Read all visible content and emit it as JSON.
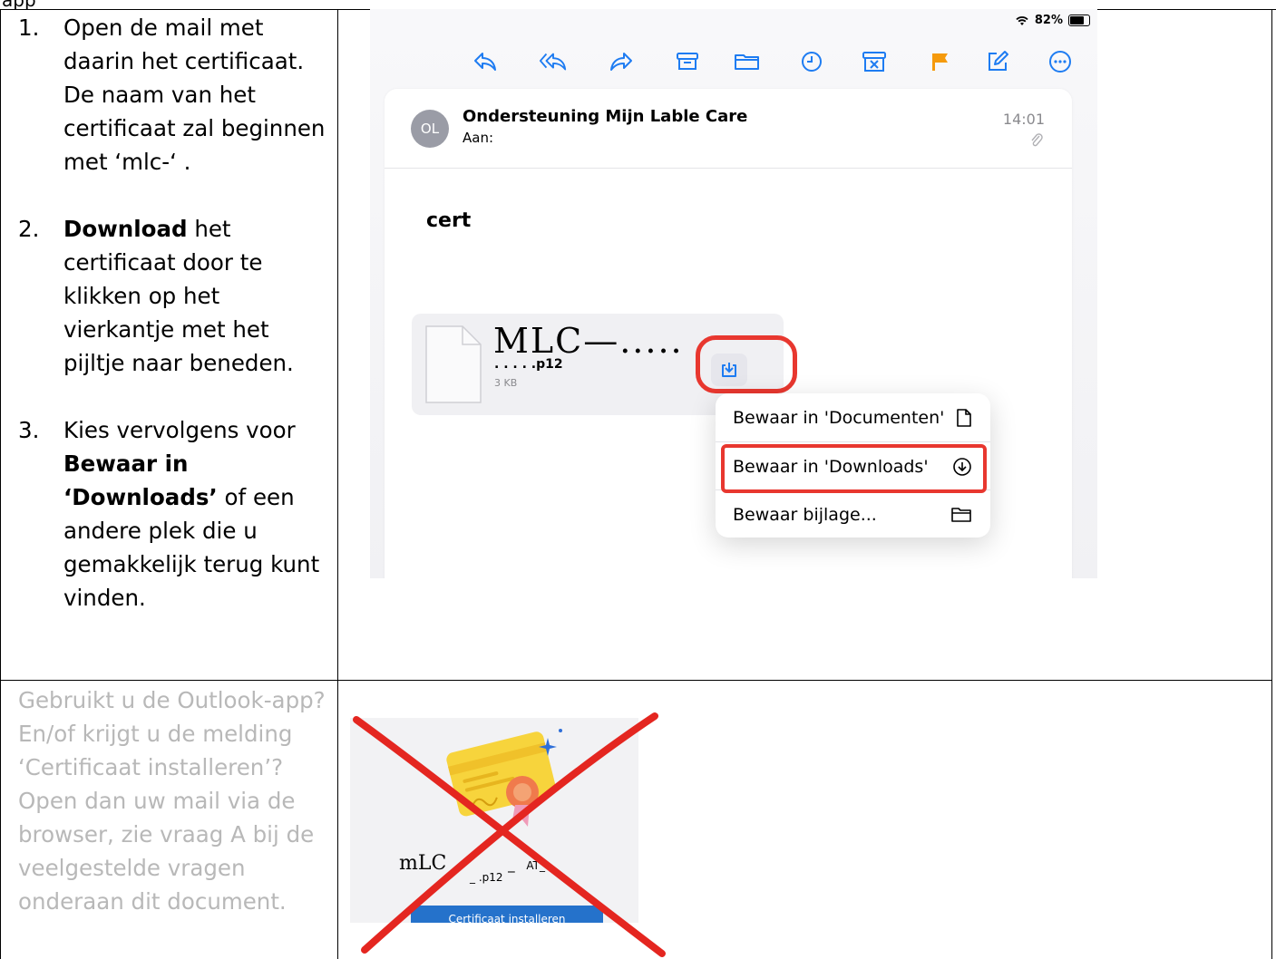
{
  "header_fragment": "app",
  "steps": [
    {
      "num": "1.",
      "parts": [
        "Open de mail met daarin het certificaat. De naam van het certificaat zal beginnen met ‘mlc-‘ ."
      ]
    },
    {
      "num": "2.",
      "bold": "Download",
      "rest": " het certificaat door te klikken op het vierkantje met het pijltje naar beneden."
    },
    {
      "num": "3.",
      "pre": "Kies vervolgens voor ",
      "bold": "Bewaar in ‘Downloads’",
      "rest": " of een andere plek die u gemakkelijk terug kunt vinden."
    }
  ],
  "note": "Gebruikt u de Outlook-app? En/of krijgt u de melding ‘Certificaat installeren’? Open dan uw mail via de browser, zie vraag A bij de veelgestelde vragen onderaan dit document.",
  "mail_screenshot": {
    "battery": "82%",
    "toolbar_icons": [
      "reply-icon",
      "reply-all-icon",
      "forward-icon",
      "archive-icon",
      "folder-icon",
      "clock-icon",
      "junk-icon",
      "flag-icon",
      "compose-icon",
      "more-icon"
    ],
    "avatar_initials": "OL",
    "sender": "Ondersteuning Mijn Lable Care",
    "to_label": "Aan:",
    "time": "14:01",
    "subject": "cert",
    "attachment_scrawl": "MLC—.....",
    "attachment_name": ". . . . .p12",
    "attachment_size": "3 KB",
    "menu": [
      {
        "label": "Bewaar in 'Documenten'",
        "icon": "document-icon"
      },
      {
        "label": "Bewaar in 'Downloads'",
        "icon": "download-circle-icon"
      },
      {
        "label": "Bewaar bijlage...",
        "icon": "folder-icon"
      }
    ]
  },
  "outlook_screenshot": {
    "file_scrawl": "mLC_",
    "file_mid": "_",
    "file_at": "AT_",
    "file_ext": "_  .p12",
    "button": "Certificaat installeren"
  },
  "colors": {
    "highlight": "#e8372f",
    "ios_blue": "#1e7cf2",
    "note_gray": "#b8b8b8"
  }
}
